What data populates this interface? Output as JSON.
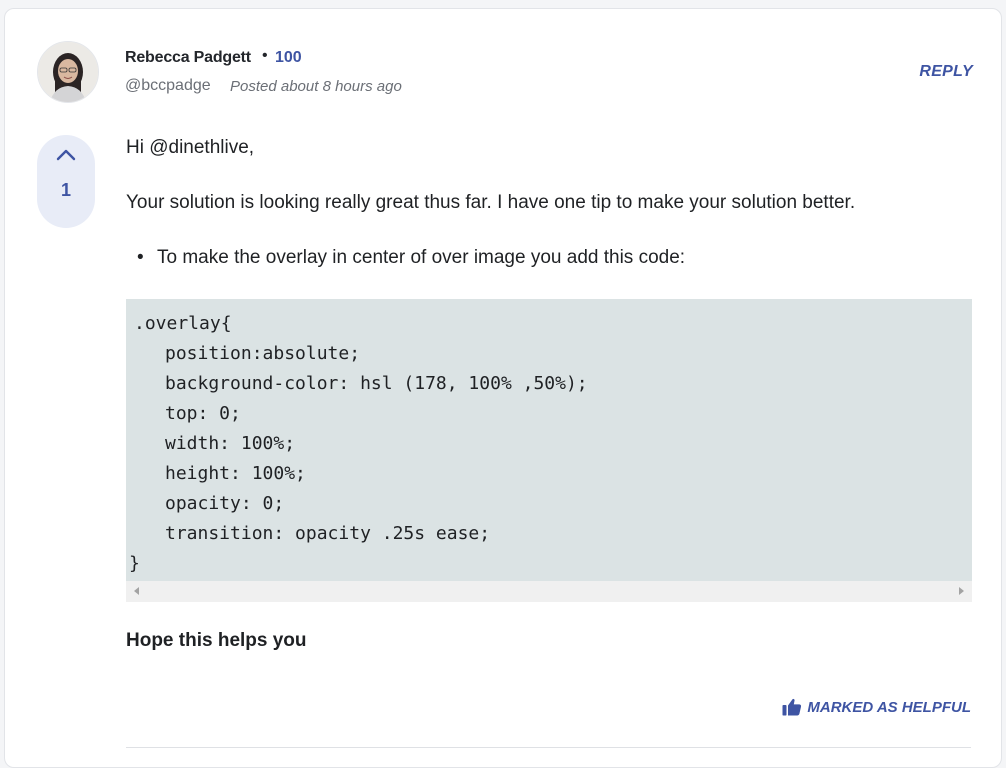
{
  "comment": {
    "author": {
      "name": "Rebecca Padgett",
      "separator": "•",
      "score": "100",
      "handle": "@bccpadge",
      "posted": "Posted about 8 hours ago"
    },
    "reply_label": "REPLY",
    "votes": {
      "count": "1",
      "icon": "chevron-up-icon"
    },
    "greeting": "Hi @dinethlive,",
    "paragraph": "Your solution is looking really great thus far. I have one tip to make your solution better.",
    "bullets": [
      "To make the overlay in center of over image you add this code:"
    ],
    "code": {
      "lines": [
        ".overlay{",
        "position:absolute;",
        "background-color: hsl (178, 100% ,50%);",
        "top: 0;",
        "width: 100%;",
        "height: 100%;",
        "opacity: 0;",
        "transition: opacity .25s ease;",
        "}"
      ]
    },
    "closing": "Hope this helps you",
    "helpful_label": "MARKED AS HELPFUL",
    "helpful_icon": "thumbs-up-icon"
  },
  "colors": {
    "accent": "#3e54a3",
    "vote_bg": "#e8ecf7",
    "code_bg": "#dbe3e4"
  }
}
